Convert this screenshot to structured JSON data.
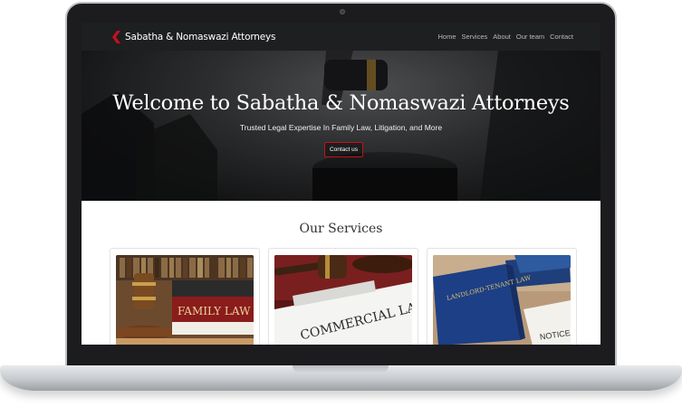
{
  "brand": {
    "name": "Sabatha & Nomaswazi Attorneys",
    "accent": "#c4121b"
  },
  "nav": {
    "links": [
      "Home",
      "Services",
      "About",
      "Our team",
      "Contact"
    ]
  },
  "hero": {
    "title": "Welcome to Sabatha & Nomaswazi Attorneys",
    "subtitle": "Trusted Legal Expertise In Family Law, Litigation, and More",
    "cta": "Contact us"
  },
  "services": {
    "title": "Our Services",
    "cards": [
      {
        "image": "family-law-gavel-image",
        "image_text": "FAMILY LAW"
      },
      {
        "image": "commercial-law-gavel-image",
        "image_text": "COMMERCIAL LAW"
      },
      {
        "image": "landlord-tenant-law-book-image",
        "image_text": "LANDLORD-TENANT LAW"
      }
    ]
  }
}
